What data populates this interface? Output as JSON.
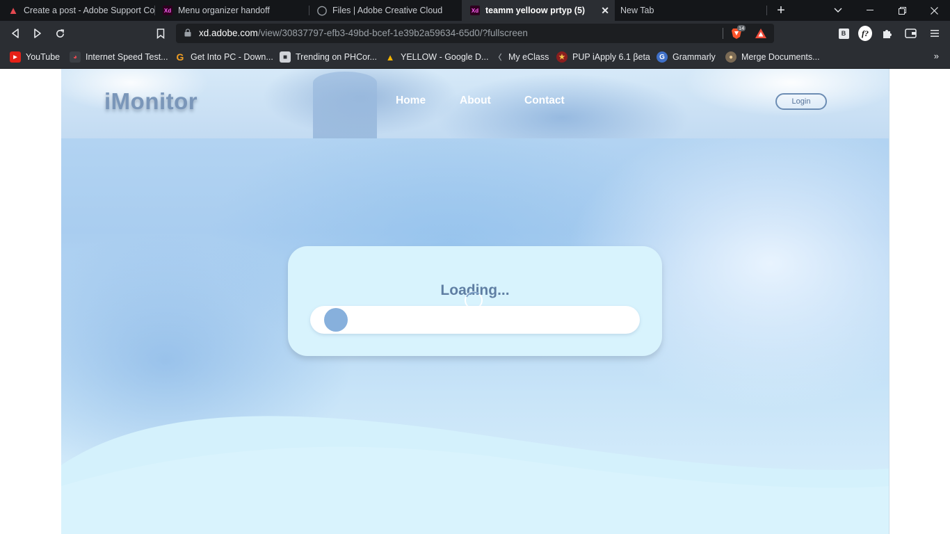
{
  "browser": {
    "tabs": [
      {
        "title": "Create a post - Adobe Support Co",
        "icon": "adobe-icon",
        "active": false
      },
      {
        "title": "Menu organizer handoff",
        "icon": "xd-icon",
        "active": false
      },
      {
        "title": "Files | Adobe Creative Cloud",
        "icon": "creative-cloud-icon",
        "active": false
      },
      {
        "title": "teamm yelloow prtyp (5)",
        "icon": "xd-icon",
        "active": true
      },
      {
        "title": "New Tab",
        "icon": "",
        "active": false
      }
    ],
    "favicon_xd_label": "Xd",
    "new_tab_glyph": "+",
    "url": {
      "host": "xd.adobe.com",
      "path": "/view/30837797-efb3-49bd-bcef-1e39b2a59634-65d0/?fullscreen"
    },
    "shield_count": "14",
    "ext_b_label": "B",
    "ext_f_label": "f?",
    "bookmarks": [
      {
        "label": "YouTube",
        "icon": "youtube-icon"
      },
      {
        "label": "Internet Speed Test...",
        "icon": "speedtest-icon"
      },
      {
        "label": "Get Into PC - Down...",
        "icon": "getintopc-icon"
      },
      {
        "label": "Trending on PHCor...",
        "icon": "phcorner-icon"
      },
      {
        "label": "YELLOW - Google D...",
        "icon": "google-drive-icon"
      },
      {
        "label": "My eClass",
        "icon": "eclass-icon"
      },
      {
        "label": "PUP iApply 6.1 βeta",
        "icon": "pup-icon"
      },
      {
        "label": "Grammarly",
        "icon": "grammarly-icon"
      },
      {
        "label": "Merge Documents...",
        "icon": "merge-docs-icon"
      }
    ],
    "bookmarks_more": "»"
  },
  "site": {
    "logo": "iMonitor",
    "nav": {
      "home": "Home",
      "about": "About",
      "contact": "Contact"
    },
    "login": "Login",
    "loading": {
      "text": "Loading...",
      "progress_fraction": 0.07
    }
  },
  "colors": {
    "accent": "#87b0dc",
    "logo": "#7a96b9",
    "card": "#d8f3fd",
    "loading_text": "#5f7ea3"
  }
}
